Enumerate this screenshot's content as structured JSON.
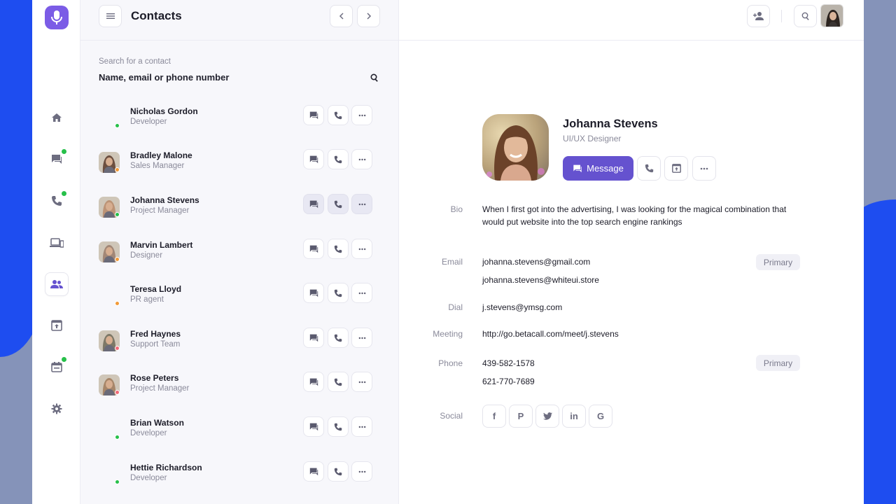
{
  "contacts_panel": {
    "title": "Contacts",
    "search_label": "Search for a contact",
    "search_value": "Name, email or phone number",
    "list": [
      {
        "name": "Nicholas Gordon",
        "role": "Developer",
        "status_color": "#27c04a",
        "has_photo": false
      },
      {
        "name": "Bradley Malone",
        "role": "Sales Manager",
        "status_color": "#f29a38",
        "has_photo": true,
        "photo_tone": "#5b3a2a"
      },
      {
        "name": "Johanna Stevens",
        "role": "Project Manager",
        "status_color": "#27c04a",
        "has_photo": true,
        "photo_tone": "#b88a6a"
      },
      {
        "name": "Marvin Lambert",
        "role": "Designer",
        "status_color": "#f29a38",
        "has_photo": true,
        "photo_tone": "#9a7b6a"
      },
      {
        "name": "Teresa Lloyd",
        "role": "PR agent",
        "status_color": "#f29a38",
        "has_photo": false
      },
      {
        "name": "Fred Haynes",
        "role": "Support Team",
        "status_color": "#f26a78",
        "has_photo": true,
        "photo_tone": "#6e6a58"
      },
      {
        "name": "Rose Peters",
        "role": "Project Manager",
        "status_color": "#f26a78",
        "has_photo": true,
        "photo_tone": "#a07a5a"
      },
      {
        "name": "Brian Watson",
        "role": "Developer",
        "status_color": "#27c04a",
        "has_photo": false
      },
      {
        "name": "Hettie Richardson",
        "role": "Developer",
        "status_color": "#27c04a",
        "has_photo": false
      }
    ]
  },
  "profile": {
    "name": "Johanna Stevens",
    "role": "UI/UX Designer",
    "message_label": "Message",
    "bio_label": "Bio",
    "bio": "When I first got into the advertising, I was looking for the magical combination that would put website into the top search engine rankings",
    "email_label": "Email",
    "email_primary": "johanna.stevens@gmail.com",
    "email_secondary": "johanna.stevens@whiteui.store",
    "dial_label": "Dial",
    "dial": "j.stevens@ymsg.com",
    "meeting_label": "Meeting",
    "meeting": "http://go.betacall.com/meet/j.stevens",
    "phone_label": "Phone",
    "phone_primary": "439-582-1578",
    "phone_secondary": "621-770-7689",
    "primary_badge": "Primary",
    "social_label": "Social",
    "social": [
      "f",
      "P",
      "t",
      "in",
      "G"
    ]
  },
  "colors": {
    "accent": "#6552cf",
    "logo": "#7b5ce6",
    "online": "#27c04a",
    "away": "#f29a38",
    "busy": "#f26a78",
    "background_blue": "#1e4df0"
  },
  "icons": {
    "sidebar": [
      "home-icon",
      "chat-icon",
      "phone-icon",
      "devices-icon",
      "contacts-icon",
      "upload-icon",
      "calendar-icon",
      "settings-icon"
    ],
    "header": [
      "menu-icon",
      "chevron-left-icon",
      "chevron-right-icon",
      "add-user-icon",
      "search-icon"
    ]
  }
}
